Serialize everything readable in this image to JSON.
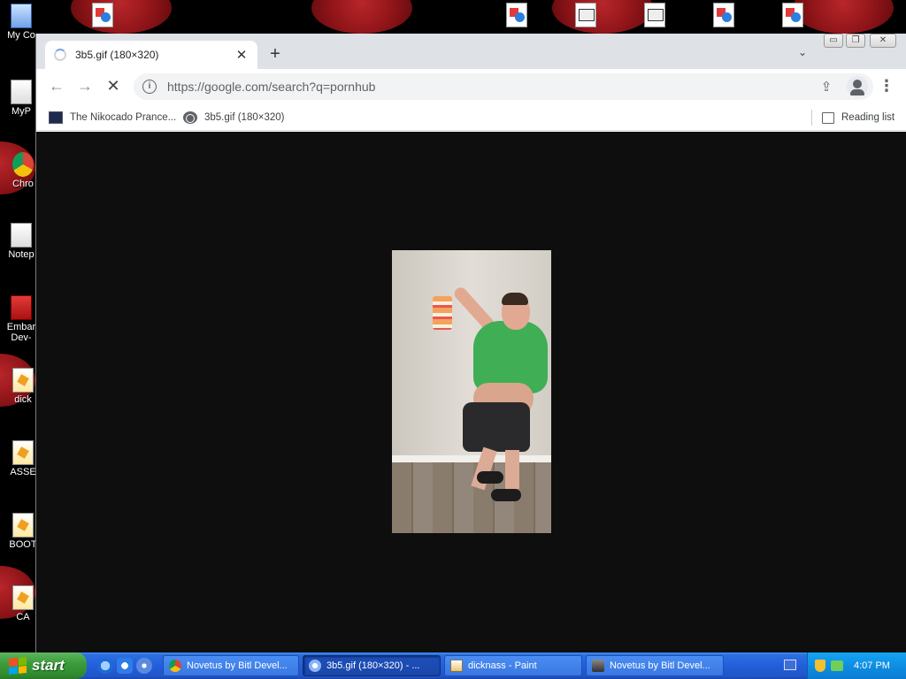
{
  "desktop": {
    "icons": [
      {
        "name": "my-computer",
        "label": "My Co"
      },
      {
        "name": "my-documents",
        "label": "MyP"
      },
      {
        "name": "chrome",
        "label": "Chro"
      },
      {
        "name": "notepad",
        "label": "Notep"
      },
      {
        "name": "embarcadero",
        "label": "Embar\nDev-"
      },
      {
        "name": "dick",
        "label": "dick"
      },
      {
        "name": "asse",
        "label": "ASSE"
      },
      {
        "name": "boot",
        "label": "BOOT"
      },
      {
        "name": "ca",
        "label": "CA"
      }
    ]
  },
  "browser": {
    "tab": {
      "title": "3b5.gif (180×320)",
      "close_glyph": "✕"
    },
    "new_tab_glyph": "+",
    "tab_search_glyph": "⌄",
    "window_controls": {
      "minimize": "▭",
      "restore": "❐",
      "close": "✕"
    },
    "toolbar": {
      "back_glyph": "←",
      "forward_glyph": "→",
      "stop_glyph": "✕",
      "info_glyph": "i",
      "url": "https://google.com/search?q=pornhub",
      "share_glyph": "⇪",
      "star_glyph": "☆",
      "menu_glyph": "⋮"
    },
    "bookmarks": [
      {
        "label": "The Nikocado Prance...",
        "icon": "site-favicon-icon"
      },
      {
        "label": "3b5.gif (180×320)",
        "icon": "globe-icon"
      }
    ],
    "reading_list": "Reading list",
    "viewport": {
      "image": "3b5.gif",
      "image_width": 180,
      "image_height": 320,
      "background": "#0e0e0e"
    }
  },
  "taskbar": {
    "start_label": "start",
    "tasks": [
      {
        "label": "Novetus by Bitl Devel...",
        "icon": "chrome-icon",
        "active": false
      },
      {
        "label": "3b5.gif (180×320) - ...",
        "icon": "chrome-icon",
        "active": true
      },
      {
        "label": "dicknass - Paint",
        "icon": "paint-icon",
        "active": false
      },
      {
        "label": "Novetus by Bitl Devel...",
        "icon": "novetus-icon",
        "active": false
      }
    ],
    "clock": "4:07 PM"
  },
  "colors": {
    "taskbar": "#245edb",
    "start": "#3c9c3c",
    "tray": "#0e8ee3",
    "tab_strip": "#dee1e6"
  }
}
